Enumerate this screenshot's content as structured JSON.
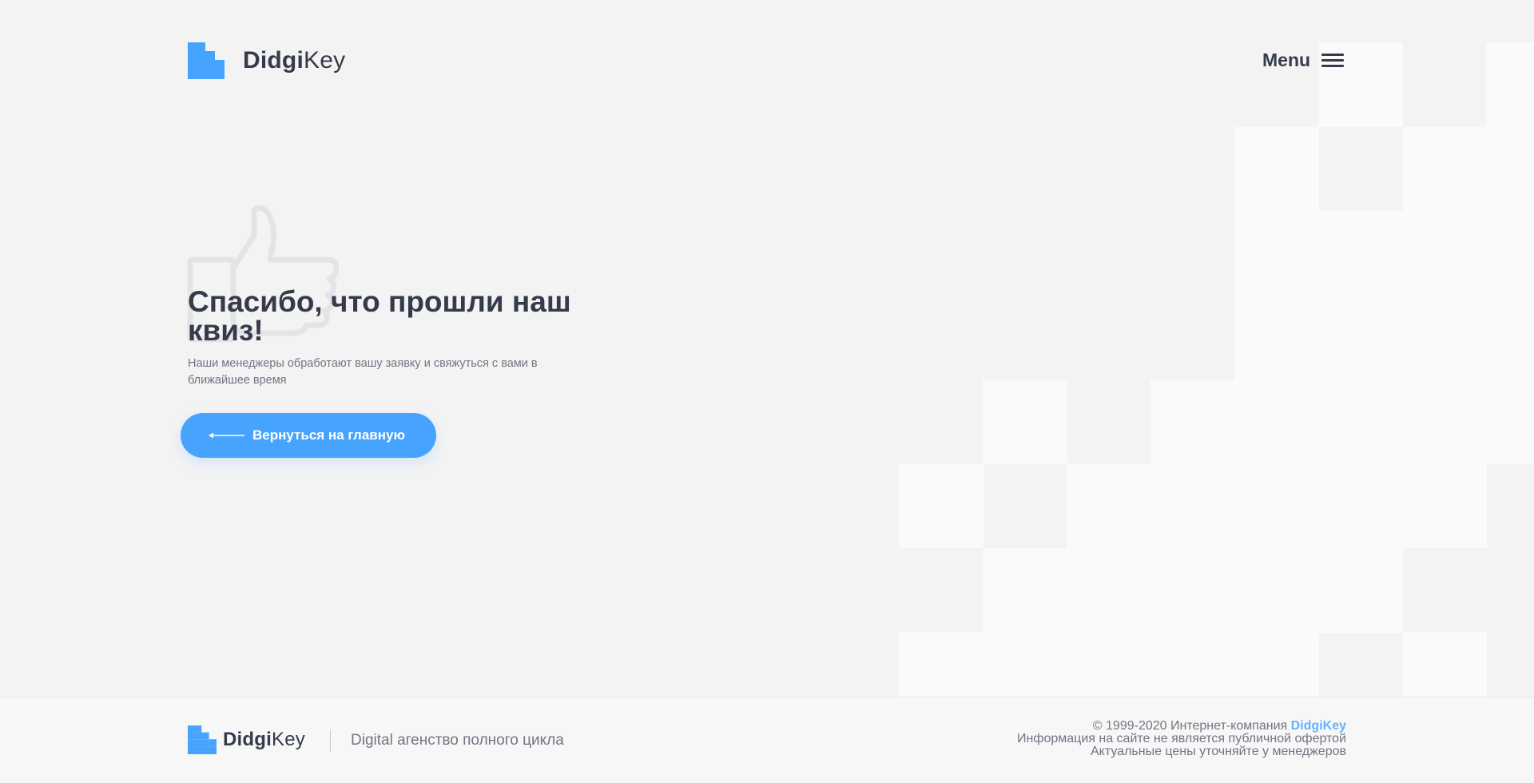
{
  "header": {
    "logo": {
      "bold": "Didgi",
      "light": "Key",
      "icon": "didgikey-logo-icon"
    },
    "menu_label": "Menu",
    "menu_icon": "hamburger-icon"
  },
  "hero": {
    "icon": "thumbs-up-icon",
    "title": "Спасибо, что прошли наш квиз!",
    "subtitle": "Наши менеджеры обработают вашу заявку и свяжуться с вами в ближайшее время",
    "back_button_label": "Вернуться на главную",
    "back_button_icon": "arrow-left-icon"
  },
  "footer": {
    "logo": {
      "bold": "Didgi",
      "light": "Key"
    },
    "tagline": "Digital агенство полного цикла",
    "copyright_prefix": "© 1999-2020 Интернет-компания ",
    "copyright_brand": "DidgiKey",
    "disclaimer_line": "Информация на сайте не является публичной офертой",
    "prices_line": "Актуальные цены уточняйте у менеджеров"
  },
  "colors": {
    "accent": "#46a4ff",
    "text_dark": "#353b4b",
    "text_muted": "#727582",
    "background": "#f3f3f3",
    "pattern_light": "#fafafa",
    "brand_link": "#64b4ff"
  }
}
